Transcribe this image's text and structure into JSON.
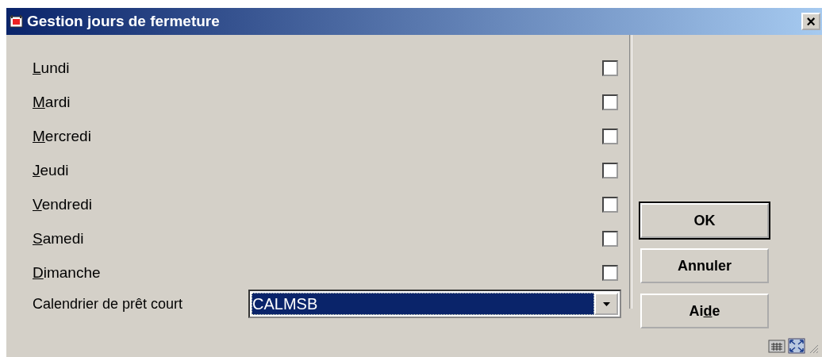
{
  "window": {
    "title": "Gestion jours de fermeture",
    "close": "×"
  },
  "days": [
    {
      "key": "L",
      "post": "undi",
      "checked": false
    },
    {
      "key": "M",
      "post": "ardi",
      "checked": false
    },
    {
      "key": "M",
      "post": "ercredi",
      "checked": false
    },
    {
      "key": "J",
      "post": "eudi",
      "checked": false
    },
    {
      "key": "V",
      "post": "endredi",
      "checked": false
    },
    {
      "key": "S",
      "post": "amedi",
      "checked": false
    },
    {
      "key": "D",
      "post": "imanche",
      "checked": false
    }
  ],
  "calendar": {
    "label": "Calendrier de prêt court",
    "value": "CALMSB"
  },
  "buttons": [
    {
      "post": "OK",
      "default": true
    },
    {
      "post": "Annuler",
      "default": false
    },
    {
      "pre": "Ai",
      "key": "d",
      "post": "e",
      "default": false
    }
  ]
}
